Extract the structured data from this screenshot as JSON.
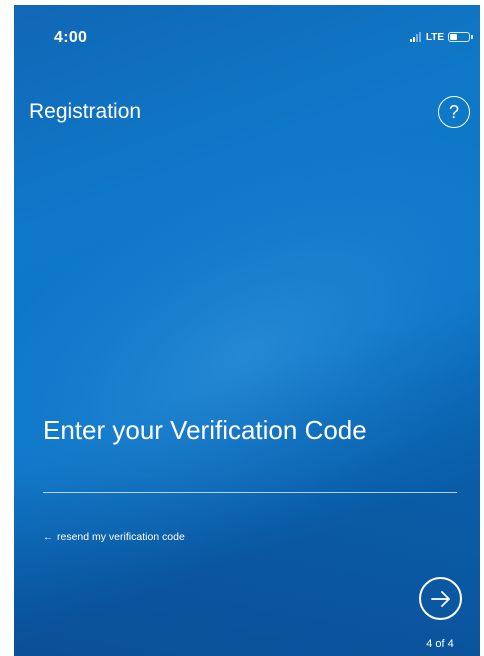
{
  "status_bar": {
    "time": "4:00",
    "network": "LTE",
    "signal_bars_filled": 2,
    "signal_bars_total": 4,
    "battery_level": 0.4
  },
  "header": {
    "title": "Registration",
    "help_label": "?"
  },
  "verification": {
    "value": "",
    "placeholder": "Enter your Verification Code"
  },
  "resend": {
    "arrow": "←",
    "label": "resend my verification code"
  },
  "footer": {
    "next_icon": "arrow-right-circle-icon",
    "step": "4 of 4"
  },
  "colors": {
    "background": "#0d76c7",
    "foreground": "#ffffff"
  }
}
